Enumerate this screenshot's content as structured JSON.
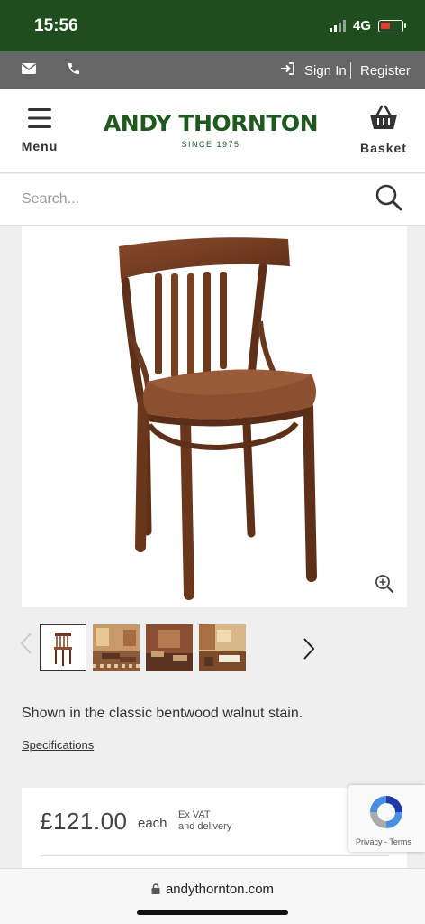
{
  "status_bar": {
    "time": "15:56",
    "network": "4G",
    "colors": {
      "background": "#1e4d1e",
      "battery": "#e53935"
    }
  },
  "top_bar": {
    "sign_in": "Sign In",
    "separator": "|",
    "register": "Register"
  },
  "header": {
    "menu_label": "Menu",
    "logo_title": "ANDY THORNTON",
    "logo_subtitle": "SINCE 1975",
    "basket_label": "Basket",
    "brand_color": "#1e5a1e"
  },
  "search": {
    "placeholder": "Search..."
  },
  "product": {
    "caption": "Shown in the classic bentwood walnut stain.",
    "specifications_link": "Specifications",
    "thumbnails": [
      "chair-thumbnail",
      "restaurant-interior-1",
      "restaurant-interior-2",
      "restaurant-interior-3"
    ]
  },
  "pricing": {
    "price": "£121.00",
    "unit": "each",
    "vat_line1": "Ex VAT",
    "vat_line2": "and delivery"
  },
  "recaptcha": {
    "privacy": "Privacy",
    "dash": "-",
    "terms": "Terms"
  },
  "browser": {
    "url": "andythornton.com"
  }
}
